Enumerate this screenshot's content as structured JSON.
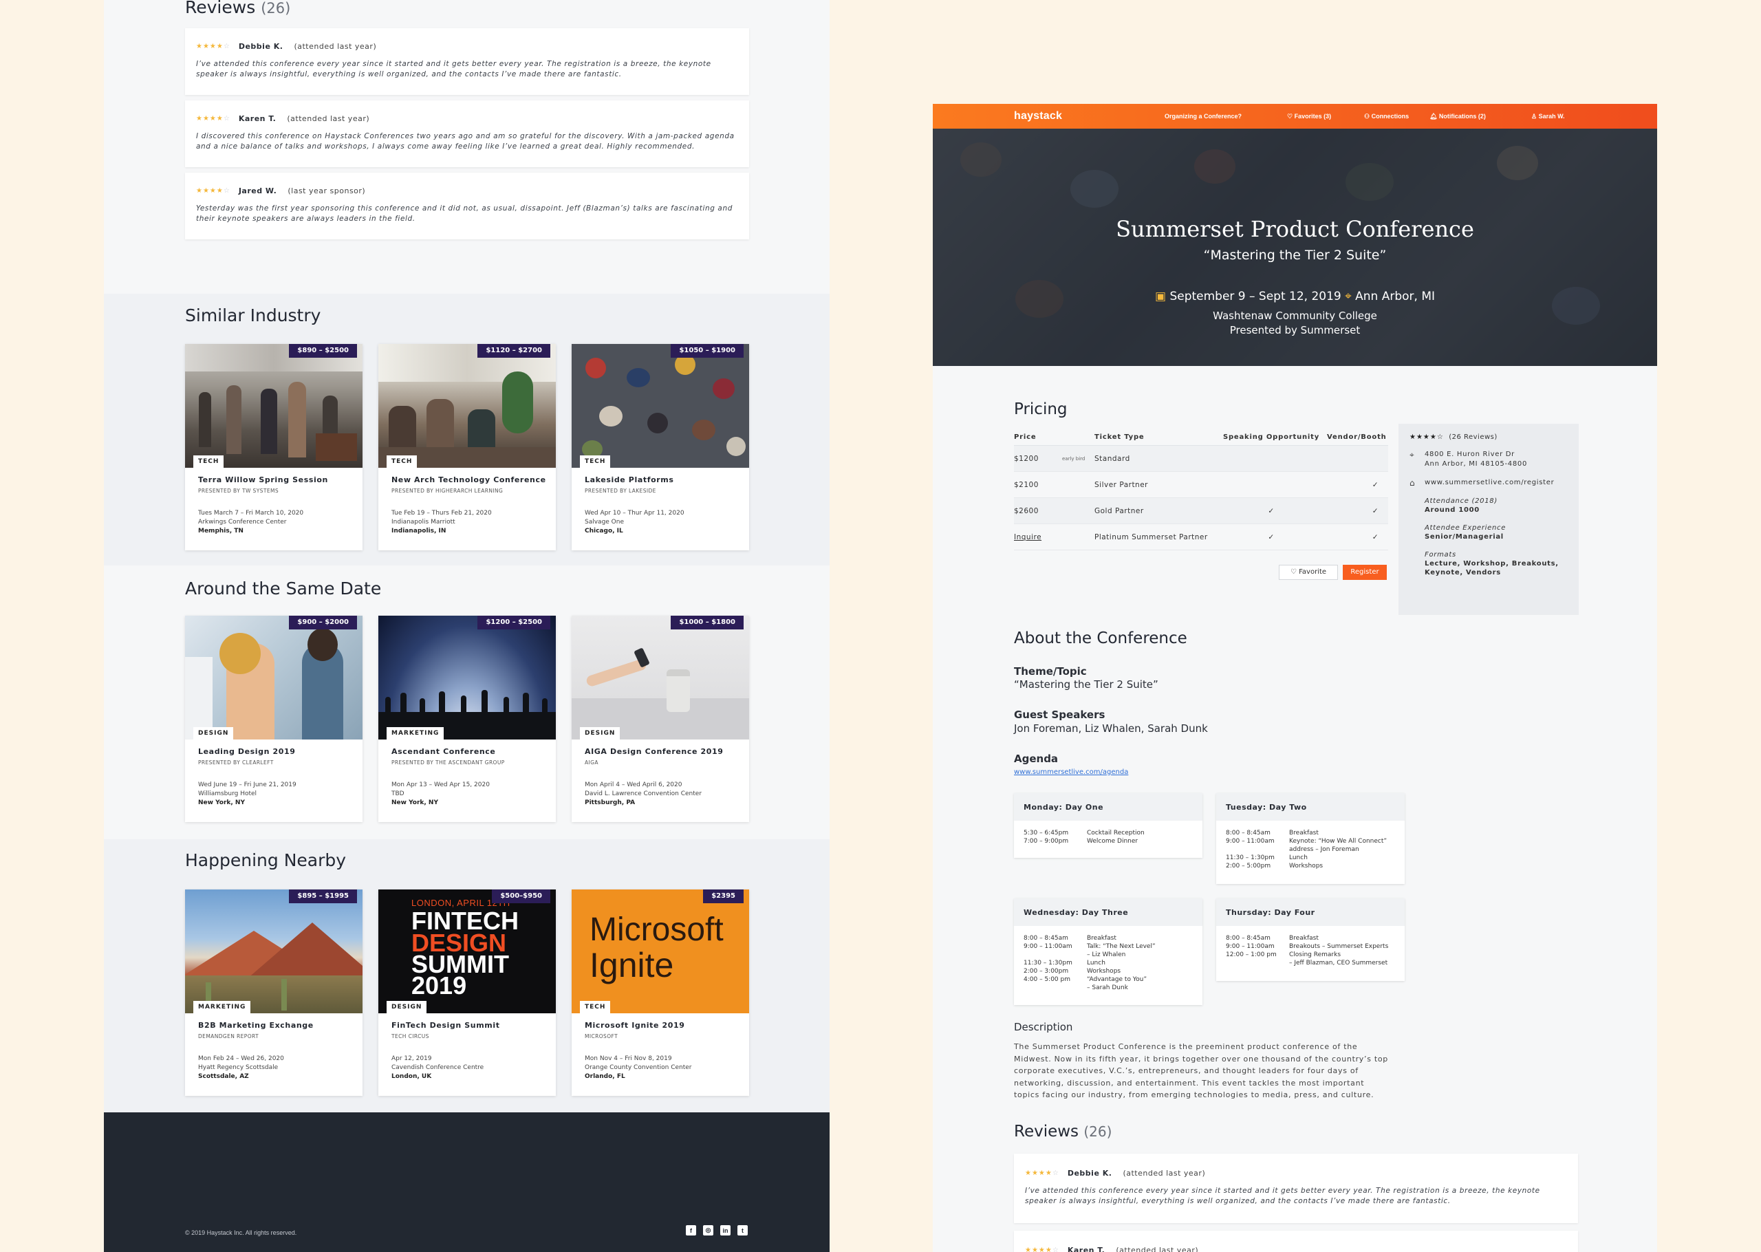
{
  "left": {
    "reviews": {
      "title": "Reviews",
      "count": "(26)",
      "items": [
        {
          "stars": "★★★★",
          "stars_off": "☆",
          "name": "Debbie K.",
          "note": "(attended last year)",
          "text": "I’ve attended this conference every year since it started and it gets better every year. The registration is a breeze, the keynote speaker is always insightful, everything is well organized, and the contacts I’ve made there are fantastic."
        },
        {
          "stars": "★★★★",
          "stars_off": "☆",
          "name": "Karen T.",
          "note": "(attended last year)",
          "text": "I discovered this conference on Haystack Conferences two years ago and am so grateful for the discovery. With a jam-packed agenda and a nice balance of talks and workshops, I always come away feeling like I’ve learned a great deal. Highly recommended."
        },
        {
          "stars": "★★★★",
          "stars_off": "☆",
          "name": "Jared W.",
          "note": "(last year sponsor)",
          "text": "Yesterday was the first year sponsoring this conference and it did not, as usual, dissapoint. Jeff (Blazman’s) talks are fascinating and their keynote speakers are always leaders in the field."
        }
      ]
    },
    "similar": {
      "title": "Similar Industry",
      "cards": [
        {
          "price": "$890 – $2500",
          "tag": "TECH",
          "name": "Terra Willow Spring Session",
          "presenter": "PRESENTED BY TW SYSTEMS",
          "date": "Tues March 7 – Fri March 10, 2020",
          "venue": "Arkwings Conference Center",
          "city": "Memphis, TN"
        },
        {
          "price": "$1120 – $2700",
          "tag": "TECH",
          "name": "New Arch Technology Conference",
          "presenter": "PRESENTED BY HIGHERARCH LEARNING",
          "date": "Tue Feb 19 – Thurs Feb 21, 2020",
          "venue": "Indianapolis Marriott",
          "city": "Indianapolis, IN"
        },
        {
          "price": "$1050 – $1900",
          "tag": "TECH",
          "name": "Lakeside Platforms",
          "presenter": "PRESENTED BY LAKESIDE",
          "date": "Wed Apr 10 – Thur Apr 11, 2020",
          "venue": "Salvage One",
          "city": "Chicago, IL"
        }
      ]
    },
    "same_date": {
      "title": "Around the Same Date",
      "cards": [
        {
          "price": "$900 – $2000",
          "tag": "DESIGN",
          "name": "Leading Design 2019",
          "presenter": "PRESENTED BY CLEARLEFT",
          "date": "Wed June 19 – Fri June 21, 2019",
          "venue": "Williamsburg Hotel",
          "city": "New York, NY"
        },
        {
          "price": "$1200 – $2500",
          "tag": "MARKETING",
          "name": "Ascendant Conference",
          "presenter": "PRESENTED BY THE ASCENDANT GROUP",
          "date": "Mon Apr 13 – Wed Apr 15, 2020",
          "venue": "TBD",
          "city": "New York, NY"
        },
        {
          "price": "$1000 – $1800",
          "tag": "DESIGN",
          "name": "AIGA Design Conference 2019",
          "presenter": "AIGA",
          "date": "Mon April 4 – Wed April 6, 2020",
          "venue": "David L. Lawrence Convention Center",
          "city": "Pittsburgh, PA"
        }
      ]
    },
    "nearby": {
      "title": "Happening Nearby",
      "cards": [
        {
          "price": "$895 – $1995",
          "tag": "MARKETING",
          "name": "B2B Marketing Exchange",
          "presenter": "DEMANDGEN REPORT",
          "date": "Mon Feb 24 – Wed 26, 2020",
          "venue": "Hyatt Regency Scottsdale",
          "city": "Scottsdale, AZ"
        },
        {
          "price": "$500–$950",
          "tag": "DESIGN",
          "name": "FinTech Design Summit",
          "presenter": "TECH CIRCUS",
          "date": "Apr 12, 2019",
          "venue": "Cavendish Conference Centre",
          "city": "London, UK"
        },
        {
          "price": "$2395",
          "tag": "TECH",
          "name": "Microsoft Ignite 2019",
          "presenter": "MICROSOFT",
          "date": "Mon Nov 4 – Fri Nov 8, 2019",
          "venue": "Orange County Convention Center",
          "city": "Orlando, FL"
        }
      ]
    },
    "fintech_art": {
      "line1": "LONDON, APRIL 12TH",
      "line2": "FINTECH",
      "line3": "DESIGN",
      "line4": "SUMMIT",
      "line5": "2019"
    },
    "ignite_art": {
      "line1": "Microsoft",
      "line2": "Ignite"
    },
    "footer": {
      "copyright": "© 2019 Haystack Inc. All rights reserved.",
      "social": [
        "f",
        "◎",
        "in",
        "t"
      ]
    }
  },
  "right": {
    "nav": {
      "logo": "haystack",
      "organizing": "Organizing a Conference?",
      "favorites": "♡ Favorites (3)",
      "connections": "⚇ Connections",
      "notifications": "🔔︎ Notifications (2)",
      "user": "♙ Sarah W."
    },
    "hero": {
      "title": "Summerset Product Conference",
      "subtitle": "“Mastering the Tier 2 Suite”",
      "date": "September 9 – Sept 12, 2019",
      "location": "Ann Arbor, MI",
      "venue": "Washtenaw Community College",
      "presenter": "Presented by Summerset"
    },
    "pricing": {
      "title": "Pricing",
      "headers": [
        "Price",
        "Ticket Type",
        "Speaking Opportunity",
        "Vendor/Booth"
      ],
      "rows": [
        {
          "price": "$1200",
          "note": "early bird",
          "type": "Standard",
          "speaking": "",
          "vendor": ""
        },
        {
          "price": "$2100",
          "note": "",
          "type": "Silver Partner",
          "speaking": "",
          "vendor": "✓"
        },
        {
          "price": "$2600",
          "note": "",
          "type": "Gold Partner",
          "speaking": "✓",
          "vendor": "✓"
        },
        {
          "price": "Inquire",
          "note": "",
          "type": "Platinum Summerset Partner",
          "speaking": "✓",
          "vendor": "✓"
        }
      ],
      "favorite_label": "♡ Favorite",
      "register_label": "Register"
    },
    "info": {
      "stars": "★★★★☆",
      "reviews": "(26 Reviews)",
      "address_1": "4800 E. Huron River Dr",
      "address_2": "Ann Arbor, MI 48105-4800",
      "website": "www.summersetlive.com/register",
      "attendance_label": "Attendance (2018)",
      "attendance": "Around 1000",
      "experience_label": "Attendee Experience",
      "experience": "Senior/Managerial",
      "formats_label": "Formats",
      "formats_1": "Lecture, Workshop, Breakouts,",
      "formats_2": "Keynote, Vendors"
    },
    "about": {
      "title": "About the Conference",
      "theme_label": "Theme/Topic",
      "theme": "“Mastering the Tier 2 Suite”",
      "speakers_label": "Guest Speakers",
      "speakers": "Jon Foreman, Liz Whalen, Sarah Dunk",
      "agenda_label": "Agenda",
      "agenda_link": "www.summersetlive.com/agenda"
    },
    "agenda": [
      {
        "day": "Monday: Day One",
        "rows": [
          {
            "t": "5:30 – 6:45pm",
            "e": "Cocktail Reception"
          },
          {
            "t": "7:00 – 9:00pm",
            "e": "Welcome Dinner"
          }
        ]
      },
      {
        "day": "Tuesday: Day Two",
        "rows": [
          {
            "t": "8:00 – 8:45am",
            "e": "Breakfast"
          },
          {
            "t": "9:00 – 11:00am",
            "e": "Keynote: “How We All Connect”\naddress – Jon Foreman"
          },
          {
            "t": "11:30 – 1:30pm",
            "e": "Lunch"
          },
          {
            "t": "2:00 – 5:00pm",
            "e": "Workshops"
          }
        ]
      },
      {
        "day": "Wednesday: Day Three",
        "rows": [
          {
            "t": "8:00 – 8:45am",
            "e": "Breakfast"
          },
          {
            "t": "9:00 – 11:00am",
            "e": "Talk: “The Next Level”\n– Liz Whalen"
          },
          {
            "t": "11:30 – 1:30pm",
            "e": "Lunch"
          },
          {
            "t": "2:00 – 3:00pm",
            "e": "Workshops"
          },
          {
            "t": "4:00 – 5:00 pm",
            "e": "“Advantage to You”\n– Sarah Dunk"
          }
        ]
      },
      {
        "day": "Thursday: Day Four",
        "rows": [
          {
            "t": "8:00 – 8:45am",
            "e": "Breakfast"
          },
          {
            "t": "9:00 – 11:00am",
            "e": "Breakouts – Summerset Experts"
          },
          {
            "t": "12:00 – 1:00 pm",
            "e": "Closing Remarks\n– Jeff Blazman, CEO Summerset"
          }
        ]
      }
    ],
    "description": {
      "title": "Description",
      "text": "The Summerset Product Conference is the preeminent product conference of the Midwest. Now in its fifth year, it brings together over one thousand of the country’s top corporate executives, V.C.’s, entrepreneurs, and thought leaders for four days of networking, discussion, and entertainment. This event tackles the most important topics facing our industry, from emerging technologies to media, press, and culture."
    },
    "reviews": {
      "title": "Reviews",
      "count": "(26)",
      "items": [
        {
          "stars": "★★★★",
          "stars_off": "☆",
          "name": "Debbie K.",
          "note": "(attended last year)",
          "text": "I’ve attended this conference every year since it started and it gets better every year. The registration is a breeze, the keynote speaker is always insightful, everything is well organized, and the contacts I’ve made there are fantastic."
        },
        {
          "stars": "★★★★",
          "stars_off": "☆",
          "name": "Karen T.",
          "note": "(attended last year)"
        }
      ]
    }
  }
}
